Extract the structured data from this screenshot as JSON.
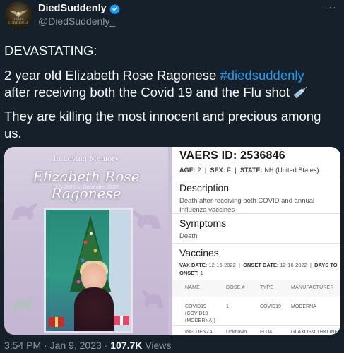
{
  "author": {
    "display_name": "DiedSuddenly",
    "handle": "@DiedSuddenly_",
    "verified": true,
    "avatar_text": "DIED SUDDENLY"
  },
  "tweet": {
    "line1": "DEVASTATING:",
    "line2_prefix": "2 year old Elizabeth Rose Ragonese ",
    "hashtag": "#diedsuddenly",
    "line2_suffix": "after receiving both the Covid 19 and the Flu shot",
    "line3": "They are killing the most innocent and precious among us."
  },
  "memorial": {
    "label": "In Loving Memory",
    "name": "Elizabeth Rose Ragonese",
    "dates": "July 2020 — December 2022"
  },
  "vaers": {
    "id_label": "VAERS ID: 2536846",
    "age_label": "AGE:",
    "age": "2",
    "sex_label": "SEX:",
    "sex": "F",
    "state_label": "STATE:",
    "state": "NH (United States)",
    "description_title": "Description",
    "description_text": "Death after receiving both COVID and annual Influenza vaccines",
    "symptoms_title": "Symptoms",
    "symptoms_text": "Death",
    "vaccines_title": "Vaccines",
    "vax_date_label": "VAX DATE:",
    "vax_date": "12-15-2022",
    "onset_date_label": "ONSET DATE:",
    "onset_date": "12-16-2022",
    "days_label": "DAYS TO ONSET:",
    "days": "1",
    "columns": [
      "NAME",
      "DOSE #",
      "TYPE",
      "MANUFACTURER"
    ],
    "rows": [
      {
        "name": "COVID19 (COVID19 (MODERNA))",
        "dose": "1",
        "type": "COVID19",
        "manufacturer": "MODERNA"
      },
      {
        "name": "INFLUENZA (SEASONAL)",
        "dose": "Unknown",
        "type": "FLU4",
        "manufacturer": "GLAXOSMITHKLINE BIOLOGICALS"
      }
    ]
  },
  "footer": {
    "time": "3:54 PM",
    "date": "Jan 9, 2023",
    "views_count": "107.7K",
    "views_label": "Views"
  },
  "colors": {
    "background": "#15202b",
    "accent": "#1d9bf0",
    "muted": "#8b98a5"
  }
}
